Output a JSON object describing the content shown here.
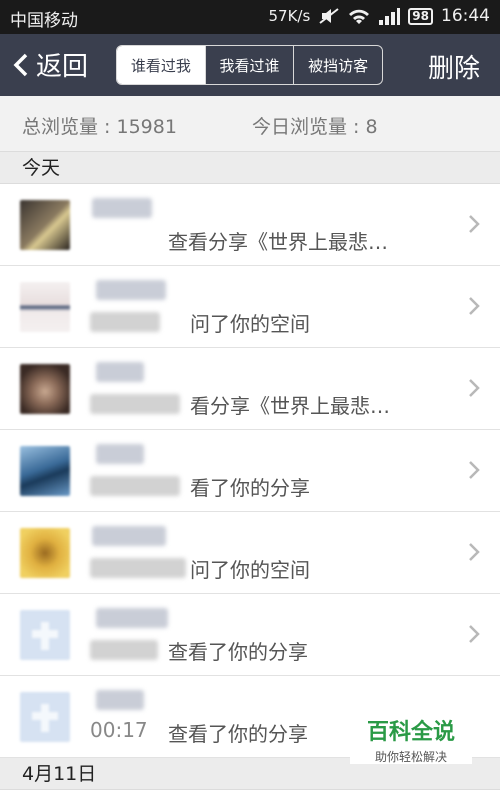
{
  "status": {
    "carrier": "中国移动",
    "speed": "57K/s",
    "battery": "98",
    "time": "16:44"
  },
  "nav": {
    "back_label": "返回",
    "tabs": [
      "谁看过我",
      "我看过谁",
      "被挡访客"
    ],
    "active_tab": 0,
    "delete_label": "删除"
  },
  "stats": {
    "total": "总浏览量 : 15981",
    "today": "今日浏览量 : 8"
  },
  "sections": {
    "today": "今天",
    "date2": "4月11日"
  },
  "visitors": [
    {
      "action": "查看分享《世界上最悲…",
      "avatar_color": "#5a5048"
    },
    {
      "action": "问了你的空间",
      "avatar_color": "#e8e4e4"
    },
    {
      "action": "看分享《世界上最悲…",
      "avatar_color": "#7a5a4a"
    },
    {
      "action": "看了你的分享",
      "avatar_color": "#4a78a8"
    },
    {
      "action": "问了你的空间",
      "avatar_color": "#d8a830"
    },
    {
      "action": "查看了你的分享",
      "avatar_color": "#d8e4f4"
    },
    {
      "action": "查看了你的分享",
      "avatar_color": "#d8e4f4",
      "time": "00:17"
    }
  ],
  "watermark": {
    "title": "百科全说",
    "subtitle": "助你轻松解决"
  }
}
